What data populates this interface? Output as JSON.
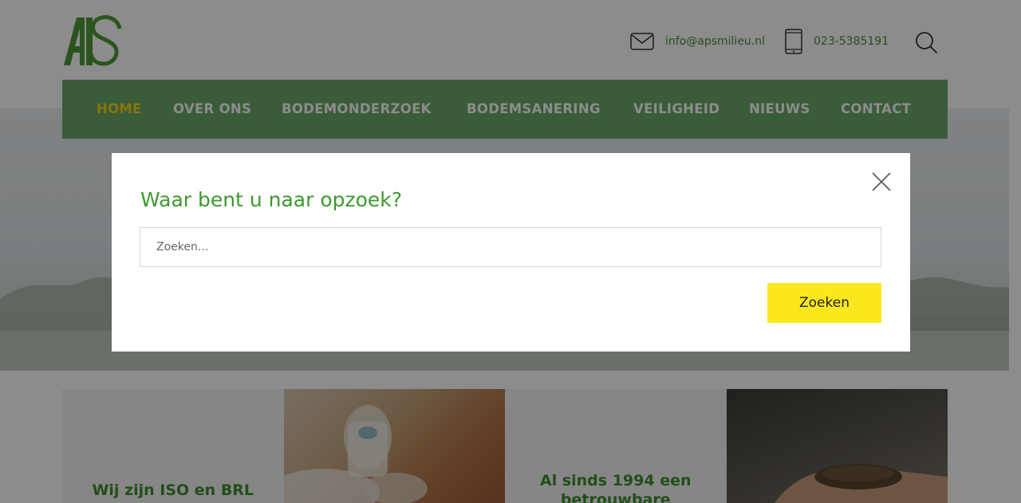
{
  "header": {
    "logo_alt": "APS",
    "email": "info@apsmilieu.nl",
    "phone": "023-5385191"
  },
  "nav": {
    "items": [
      {
        "label": "HOME",
        "active": true
      },
      {
        "label": "OVER ONS",
        "active": false
      },
      {
        "label": "BODEMONDERZOEK",
        "active": false
      },
      {
        "label": "BODEMSANERING",
        "active": false
      },
      {
        "label": "VEILIGHEID",
        "active": false
      },
      {
        "label": "NIEUWS",
        "active": false
      },
      {
        "label": "CONTACT",
        "active": false
      }
    ]
  },
  "cards": {
    "iso_title": "Wij zijn ISO en BRL",
    "since_title_line1": "Al sinds 1994 een",
    "since_title_line2": "betrouwbare"
  },
  "search_modal": {
    "title": "Waar bent u naar opzoek?",
    "placeholder": "Zoeken...",
    "submit_label": "Zoeken"
  },
  "colors": {
    "brand_green": "#6aa868",
    "title_green": "#3d9a2e",
    "nav_active": "#f6d516",
    "button_yellow": "#fae81d"
  },
  "icons": {
    "email": "envelope-icon",
    "phone": "mobile-phone-icon",
    "search": "search-icon",
    "close": "close-icon"
  }
}
